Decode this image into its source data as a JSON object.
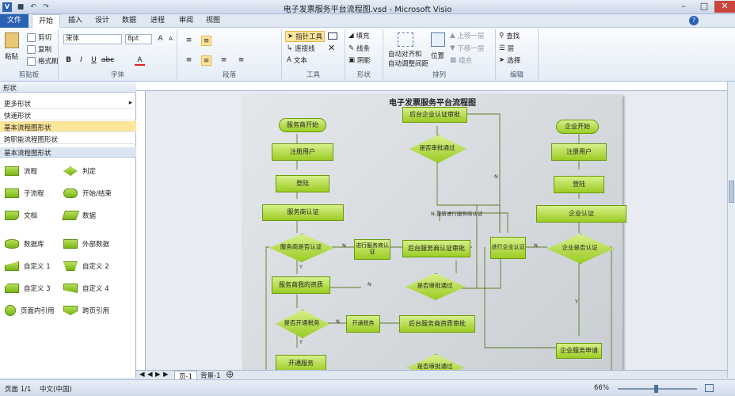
{
  "window": {
    "title": "电子发票服务平台流程图.vsd - Microsoft Visio"
  },
  "tabs": [
    "文件",
    "开始",
    "插入",
    "设计",
    "数据",
    "进程",
    "审阅",
    "视图"
  ],
  "ribbon": {
    "clipboard": {
      "label": "剪贴板",
      "paste": "粘贴",
      "cut": "剪切",
      "copy": "复制",
      "format_painter": "格式刷"
    },
    "font": {
      "label": "字体",
      "family": "宋体",
      "size": "8pt"
    },
    "paragraph": {
      "label": "段落"
    },
    "tools": {
      "label": "工具",
      "pointer": "指针工具",
      "connector": "连接线",
      "text": "文本"
    },
    "shape": {
      "label": "形状",
      "fill": "填充",
      "line": "线条",
      "shadow": "阴影"
    },
    "arrange": {
      "label": "排列",
      "auto_align": "自动对齐和",
      "auto_space": "自动调整间距",
      "position": "位置",
      "bring_forward": "上移一层",
      "send_backward": "下移一层",
      "group": "组合"
    },
    "edit": {
      "label": "编辑",
      "find": "查找",
      "layer": "层",
      "select": "选择"
    }
  },
  "shapes_pane": {
    "header": "形状",
    "more": "更多形状",
    "quick": "快速形状",
    "stencils": [
      "基本流程图形状",
      "跨职能流程图形状"
    ],
    "stencil_title": "基本流程图形状",
    "items": [
      "流程",
      "判定",
      "子流程",
      "开始/结束",
      "文档",
      "数据",
      "数据库",
      "外部数据",
      "自定义 1",
      "自定义 2",
      "自定义 3",
      "自定义 4",
      "页面内引用",
      "跨页引用"
    ]
  },
  "page_tabs": [
    "页-1",
    "背景-1"
  ],
  "status": {
    "page": "页面 1/1",
    "lang": "中文(中国)",
    "zoom": "66%"
  },
  "diagram": {
    "title": "电子发票服务平台流程图",
    "nodes": {
      "n1": "服务商开始",
      "n2": "注册用户",
      "n3": "登陆",
      "n4": "服务商认证",
      "n5": "服务商是否认证",
      "n6": "进行服务商认证",
      "n7": "后台服务商认证审批",
      "n8": "是否审批通过",
      "n9": "服务商我的资质",
      "n10": "是否开通税务",
      "n11": "开通税务",
      "n12": "后台服务商资质审批",
      "n13": "开通服务",
      "n14": "是否审批通过",
      "n15": "后台企业认证审批",
      "n16": "是否审批通过",
      "n17": "企业开始",
      "n18": "注册用户",
      "n19": "登陆",
      "n20": "企业认证",
      "n21": "企业是否认证",
      "n22": "进行企业认证",
      "n23": "企业服务申请"
    },
    "labels": {
      "no": "N",
      "yes": "Y",
      "reselect": "N.重新进行服务商认证"
    }
  }
}
